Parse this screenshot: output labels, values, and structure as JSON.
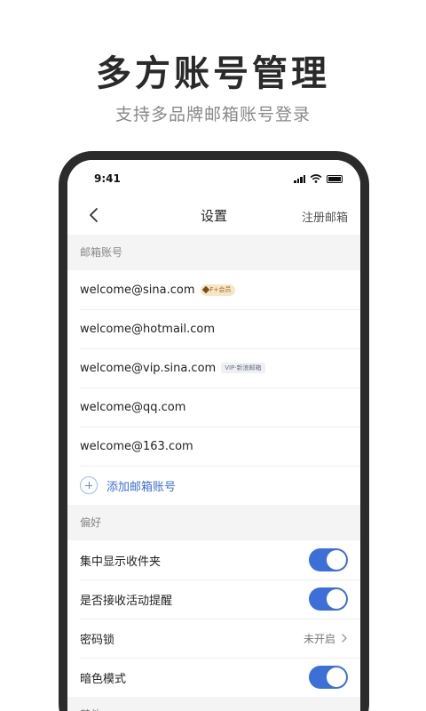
{
  "promo": {
    "title": "多方账号管理",
    "subtitle": "支持多品牌邮箱账号登录"
  },
  "status_bar": {
    "time": "9:41"
  },
  "nav": {
    "title": "设置",
    "right_action": "注册邮箱"
  },
  "sections": {
    "accounts_label": "邮箱账号",
    "preferences_label": "偏好",
    "other_label": "其他"
  },
  "accounts": [
    {
      "email": "welcome@sina.com",
      "badge": "F+会员"
    },
    {
      "email": "welcome@hotmail.com"
    },
    {
      "email": "welcome@vip.sina.com",
      "badge": "VIP·新浪邮箱"
    },
    {
      "email": "welcome@qq.com"
    },
    {
      "email": "welcome@163.com"
    }
  ],
  "add_account_label": "添加邮箱账号",
  "preferences": {
    "unified_inbox": {
      "label": "集中显示收件夹",
      "enabled": true
    },
    "activity_reminder": {
      "label": "是否接收活动提醒",
      "enabled": true
    },
    "passcode_lock": {
      "label": "密码锁",
      "value": "未开启"
    },
    "dark_mode": {
      "label": "暗色模式",
      "enabled": true
    }
  },
  "colors": {
    "accent": "#3d6fd9",
    "link": "#3b6fd8",
    "badge_gold_bg": "#f6e6c8"
  },
  "icons": {
    "back": "chevron-left-icon",
    "add": "plus-circle-icon",
    "disclosure": "chevron-right-icon",
    "signal": "signal-icon",
    "wifi": "wifi-icon",
    "battery": "battery-icon"
  }
}
